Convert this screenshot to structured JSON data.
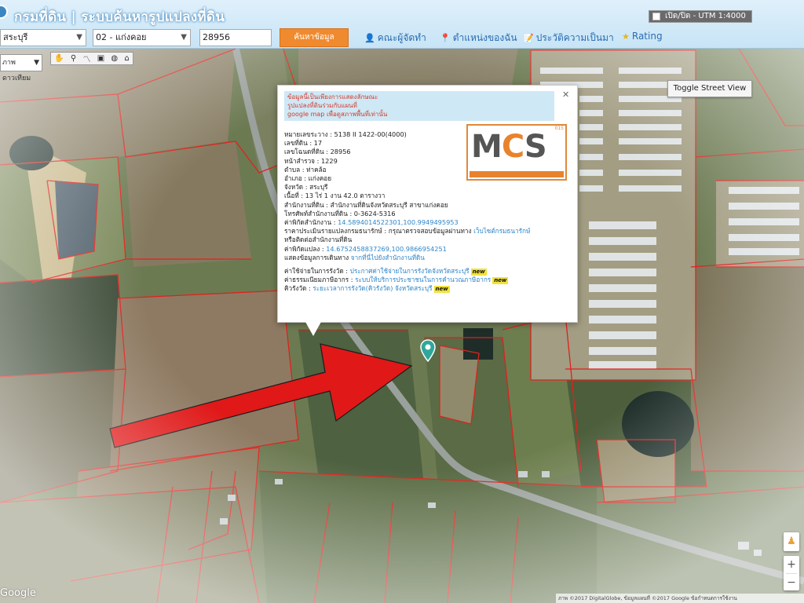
{
  "header": {
    "title": "กรมที่ดิน | ระบบค้นหารูปแปลงที่ดิน",
    "utm_label": "เปิด/ปิด - UTM 1:4000",
    "province_select": "สระบุรี",
    "amphur_select": "02 - แก่งคอย",
    "parcel_input": "28956",
    "search_button": "ค้นหาข้อมูล",
    "nav": {
      "team": "คณะผู้จัดทำ",
      "location": "ตำแหน่งของฉัน",
      "history": "ประวัติความเป็นมา",
      "rating": "Rating"
    }
  },
  "toolbar": {
    "layer_select": "ภาพดาวเทียม"
  },
  "map": {
    "street_view_button": "Toggle Street View",
    "google_logo": "Google",
    "attribution": "ภาพ ©2017 DigitalGlobe, ข้อมูลแผนที่ ©2017 Google   ข้อกำหนดการใช้งาน"
  },
  "popup": {
    "notice_line1": "ข้อมูลนี้เป็นเพียงการแสดงลักษณะ",
    "notice_line2": "รูปแปลงที่ดินร่วมกับแผนที่",
    "notice_line3": "google map เพื่อดูสภาพพื้นที่เท่านั้น",
    "sheet_label": "หมายเลขระวาง : 5138 II 1422-00(4000)",
    "parcel_no_label": "เลขที่ดิน : 17",
    "deed_no_label": "เลขโฉนดที่ดิน : 28956",
    "survey_page_label": "หน้าสำรวจ : 1229",
    "tambon_label": "ตำบล : ท่าคล้อ",
    "amphur_label": "อำเภอ : แก่งคอย",
    "province_label": "จังหวัด : สระบุรี",
    "area_label": "เนื้อที่ : 13 ไร่ 1 งาน 42.0 ตารางวา",
    "office_label": "สำนักงานที่ดิน : สำนักงานที่ดินจังหวัดสระบุรี สาขาแก่งคอย",
    "phone_label": "โทรศัพท์สำนักงานที่ดิน : 0-3624-5316",
    "office_coord_label": "ค่าพิกัดสำนักงาน : ",
    "office_coord_value": "14.5894014522301,100.9949495953",
    "appraisal_label": "ราคาประเมินรายแปลงกรมธนารักษ์ : กรุณาตรวจสอบข้อมูลผ่านทาง ",
    "appraisal_link": "เว็บไซต์กรมธนารักษ์",
    "appraisal_label2": "หรือติดต่อสำนักงานที่ดิน",
    "parcel_coord_label": "ค่าพิกัดแปลง : ",
    "parcel_coord_value": "14.6752458837269,100.9866954251",
    "route_label": "แสดงข้อมูลการเดินทาง ",
    "route_link": "จากที่นี่ไปยังสำนักงานที่ดิน",
    "announce_label": "ค่าใช้จ่ายในการรังวัด : ",
    "announce_link": "ประกาศค่าใช้จ่ายในการรังวัดจังหวัดสระบุรี",
    "fee_label": "ค่าธรรมเนียมภาษีอากร : ",
    "fee_link": "ระบบให้บริการประชาชนในการคำนวณภาษีอากร",
    "queue_label": "คิวรังวัด : ",
    "queue_link": "ระยะเวลาการรังวัด(คิวรังวัด) จังหวัดสระบุรี",
    "new_badge": "new",
    "logo_text_m": "M",
    "logo_text_c": "C",
    "logo_text_s": "S",
    "logo_tag": "015"
  },
  "colors": {
    "header_bg": "#cfe8f6",
    "accent_orange": "#f08a2f",
    "link_blue": "#2f86c9",
    "parcel_line": "#e0211d",
    "arrow_red": "#e01818"
  }
}
